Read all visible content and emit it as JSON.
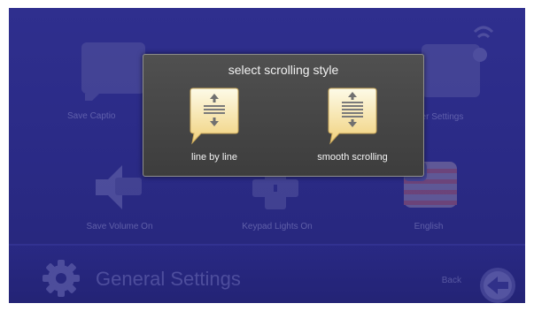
{
  "screen_title": "General Settings",
  "back_label": "Back",
  "tiles": [
    {
      "label": "Save Captio"
    },
    {
      "label": "her Settings"
    },
    {
      "label": "Save Volume On"
    },
    {
      "label": "Keypad Lights On"
    },
    {
      "label": "English"
    }
  ],
  "modal": {
    "title": "select scrolling style",
    "options": [
      {
        "label": "line by line",
        "icon": "line-by-line-icon"
      },
      {
        "label": "smooth scrolling",
        "icon": "smooth-scrolling-icon"
      }
    ]
  },
  "colors": {
    "background": "#2f2f8e",
    "modal": "#474747",
    "accent": "#f5d98a"
  }
}
